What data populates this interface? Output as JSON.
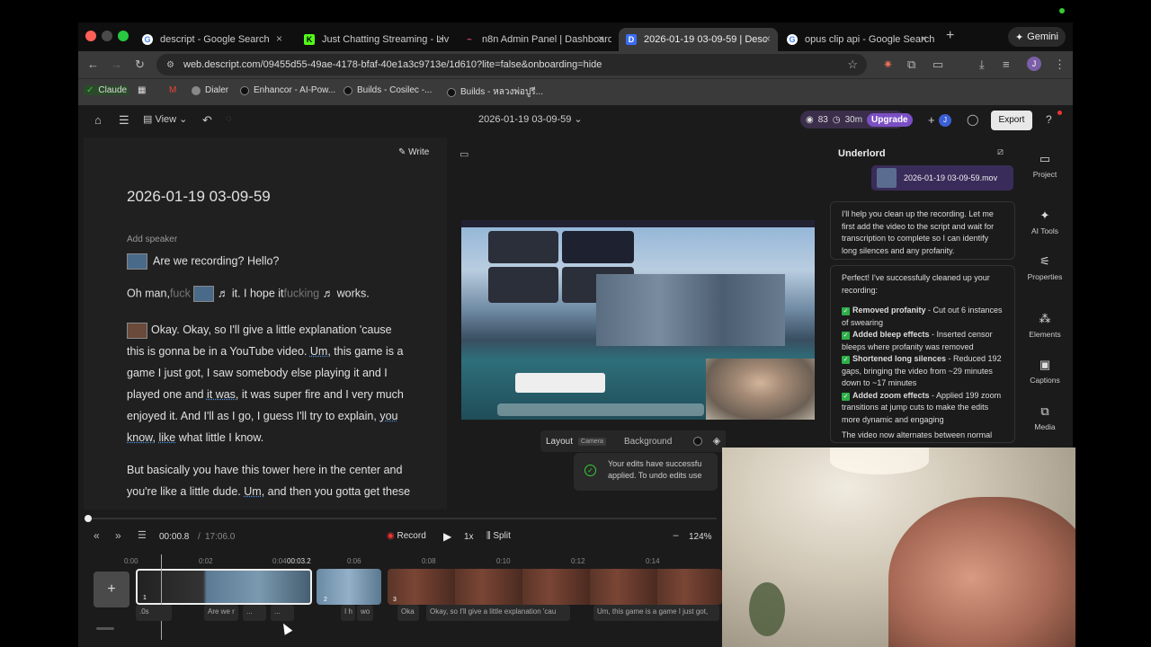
{
  "browser": {
    "tabs": [
      {
        "label": "descript - Google Search",
        "icon": "google-icon"
      },
      {
        "label": "Just Chatting Streaming - Liv",
        "icon": "kick-icon"
      },
      {
        "label": "n8n Admin Panel | Dashboard",
        "icon": "n8n-icon"
      },
      {
        "label": "2026-01-19 03-09-59 | Desc",
        "icon": "descript-icon"
      },
      {
        "label": "opus clip api - Google Search",
        "icon": "google-icon"
      }
    ],
    "gemini_label": "Gemini",
    "url": "web.descript.com/09455d55-49ae-4178-bfaf-40e1a3c9713e/1d610?lite=false&onboarding=hide",
    "profile_initial": "J",
    "bookmarks": [
      "Claude",
      "Dialer",
      "Enhancor - AI-Pow...",
      "Builds - Cosilec -...",
      "Builds - หลวงพ่อปูรี..."
    ]
  },
  "app": {
    "view_label": "View",
    "doc_title": "2026-01-19 03-09-59",
    "credits_count": "83",
    "minutes": "30m",
    "upgrade_label": "Upgrade",
    "export_label": "Export",
    "avatar_initial": "J"
  },
  "script": {
    "write_label": "Write",
    "title": "2026-01-19 03-09-59",
    "add_speaker": "Add speaker",
    "line1": "Are we recording?",
    "line1b": "Hello?",
    "l2a": "Oh man,",
    "l2b": "fuck",
    "l2c": "it. I hope it",
    "l2d": "fucking",
    "l2e": "works.",
    "p1": [
      "Okay. Okay, so I'll give a little explanation 'cause",
      "this is gonna be in a YouTube video.",
      "game I just got, I saw somebody else playing it and I",
      "played one and",
      "enjoyed it. And I'll as I go, I guess I'll try to explain,",
      "what little I know."
    ],
    "um1": "Um,",
    "p1b": "this game is a",
    "itwas": "it was,",
    "p1c": "it was super fire and I very much",
    "you": "you",
    "know": "know,",
    "like": "like",
    "p2a": "But basically you have this tower here in the center and",
    "p2b": "you're like a little dude.",
    "um2": "Um,",
    "p2c": "and then you gotta get these"
  },
  "preview": {
    "layout_label": "Layout",
    "camera_badge": "Camera",
    "background_label": "Background",
    "toast_line1": "Your edits have successfu",
    "toast_line2": "applied. To undo edits use"
  },
  "underlord": {
    "title": "Underlord",
    "file_chip": "2026-01-19 03-09-59.mov",
    "msg1": "I'll help you clean up the recording. Let me first add the video to the script and wait for transcription to complete so I can identify long silences and any profanity.",
    "msg2_intro": "Perfect! I've successfully cleaned up your recording:",
    "items": [
      {
        "bold": "Removed profanity",
        "text": " - Cut out 6 instances of swearing"
      },
      {
        "bold": "Added bleep effects",
        "text": " - Inserted censor bleeps where profanity was removed"
      },
      {
        "bold": "Shortened long silences",
        "text": " - Reduced 192 gaps, bringing the video from ~29 minutes down to ~17 minutes"
      },
      {
        "bold": "Added zoom effects",
        "text": " - Applied 199 zoom transitions at jump cuts to make the edits more dynamic and engaging"
      }
    ],
    "msg2_tail": "The video now alternates between normal"
  },
  "rail": [
    "Project",
    "AI Tools",
    "Properties",
    "Elements",
    "Captions",
    "Media"
  ],
  "timeline": {
    "current_time": "00:00.8",
    "total_time": "17:06.0",
    "record_label": "Record",
    "speed": "1x",
    "split_label": "Split",
    "zoom": "124%",
    "ruler": [
      "0:00",
      "0:02",
      "0:04",
      "0:06",
      "0:08",
      "0:10",
      "0:12",
      "0:14"
    ],
    "playhead_time": "00:03.2",
    "clip_numbers": [
      "1",
      "2",
      "3"
    ],
    "words": [
      ".0s",
      "Are we r",
      "...",
      "I h",
      "wo",
      "Oka",
      "Okay, so I'll give a little explanation 'cau",
      "Um, this game is a game I just got,"
    ]
  }
}
